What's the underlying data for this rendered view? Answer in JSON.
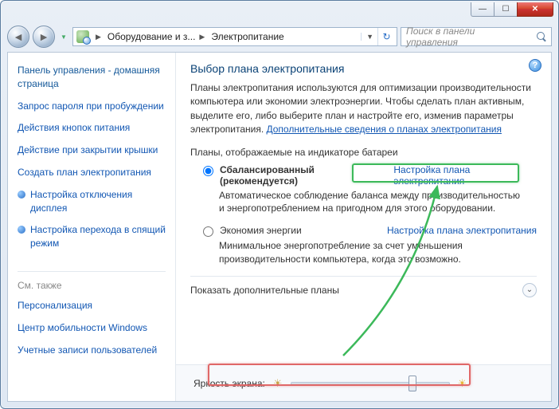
{
  "titlebar": {
    "min": "—",
    "max": "☐",
    "close": "✕"
  },
  "nav": {
    "back": "◄",
    "fwd": "►"
  },
  "breadcrumb": {
    "seg1": "Оборудование и з...",
    "seg2": "Электропитание"
  },
  "search": {
    "placeholder": "Поиск в панели управления"
  },
  "sidebar": {
    "home": "Панель управления - домашняя страница",
    "links": [
      "Запрос пароля при пробуждении",
      "Действия кнопок питания",
      "Действие при закрытии крышки",
      "Создать план электропитания"
    ],
    "bullet1": "Настройка отключения дисплея",
    "bullet2": "Настройка перехода в спящий режим",
    "see_also_label": "См. также",
    "see_also": [
      "Персонализация",
      "Центр мобильности Windows",
      "Учетные записи пользователей"
    ]
  },
  "main": {
    "title": "Выбор плана электропитания",
    "desc": "Планы электропитания используются для оптимизации производительности компьютера или экономии электроэнергии. Чтобы сделать план активным, выделите его, либо выберите план и настройте его, изменив параметры электропитания. ",
    "desc_link": "Дополнительные сведения о планах электропитания",
    "plans_label": "Планы, отображаемые на индикаторе батареи",
    "plan1_name": "Сбалансированный (рекомендуется)",
    "plan1_link": "Настройка плана электропитания",
    "plan1_desc": "Автоматическое соблюдение баланса между производительностью и энергопотреблением на пригодном для этого оборудовании.",
    "plan2_name": "Экономия энергии",
    "plan2_link": "Настройка плана электропитания",
    "plan2_desc": "Минимальное энергопотребление за счет уменьшения производительности компьютера, когда это возможно.",
    "show_more": "Показать дополнительные планы",
    "brightness_label": "Яркость экрана:",
    "help": "?"
  }
}
